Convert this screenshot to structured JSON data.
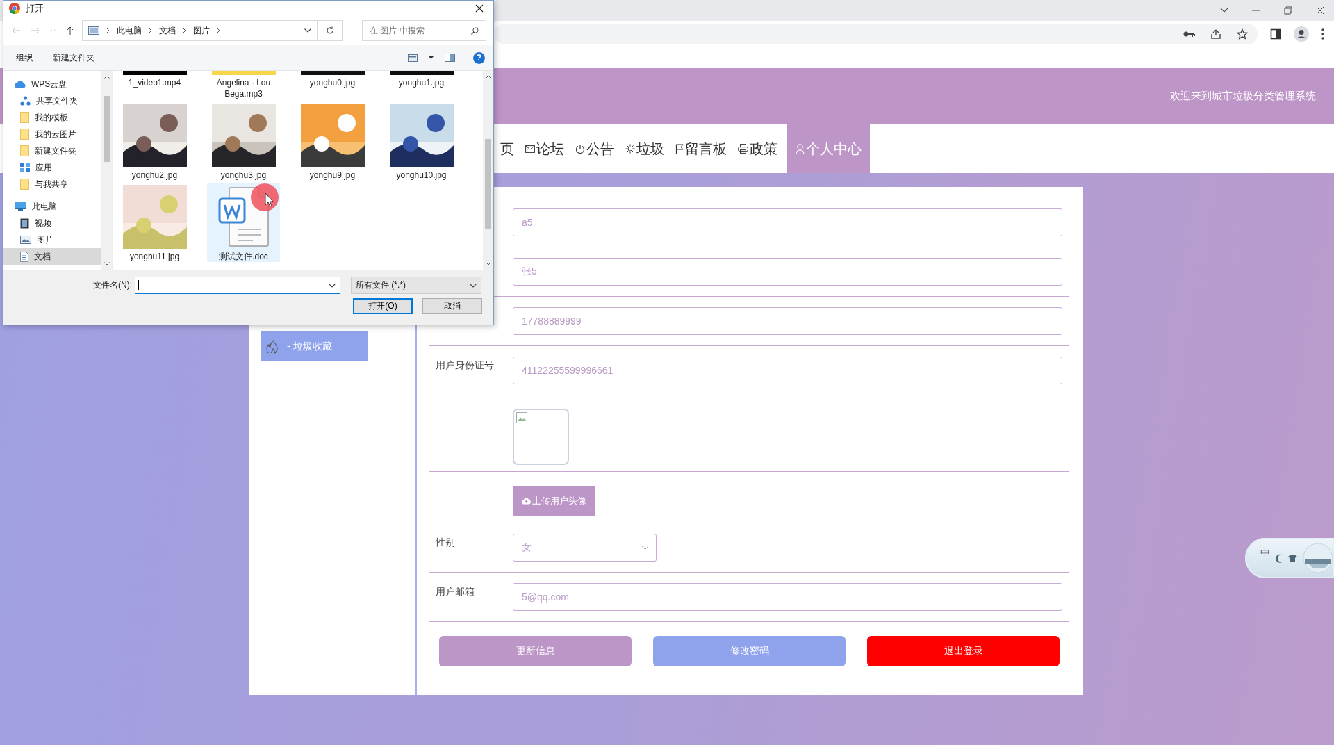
{
  "dialog": {
    "title": "打开",
    "breadcrumb": [
      "此电脑",
      "文档",
      "图片"
    ],
    "search": {
      "placeholder": "在 图片 中搜索"
    },
    "toolbar": [
      "组织",
      "新建文件夹"
    ],
    "help": "?",
    "tree": [
      {
        "label": "WPS云盘",
        "kind": "cloud",
        "selected": false,
        "children": [
          {
            "label": "共享文件夹",
            "kind": "share",
            "selected": false
          },
          {
            "label": "我的模板",
            "kind": "folder",
            "selected": false
          },
          {
            "label": "我的云图片",
            "kind": "folder",
            "selected": false
          },
          {
            "label": "新建文件夹",
            "kind": "folder",
            "selected": false
          },
          {
            "label": "应用",
            "kind": "apps",
            "selected": false
          },
          {
            "label": "与我共享",
            "kind": "folder",
            "selected": false
          }
        ]
      },
      {
        "label": "此电脑",
        "kind": "pc",
        "selected": false,
        "children": [
          {
            "label": "视频",
            "kind": "video",
            "selected": false
          },
          {
            "label": "图片",
            "kind": "picture",
            "selected": false
          },
          {
            "label": "文档",
            "kind": "document",
            "selected": true
          }
        ]
      }
    ],
    "files": [
      {
        "name": "1_video1.mp4",
        "kind": "picture",
        "selected": false
      },
      {
        "name": "Angelina - Lou Bega.mp3",
        "kind": "picture",
        "selected": false
      },
      {
        "name": "yonghu0.jpg",
        "kind": "picture",
        "selected": false
      },
      {
        "name": "yonghu1.jpg",
        "kind": "picture",
        "selected": false
      },
      {
        "name": "yonghu2.jpg",
        "kind": "picture",
        "selected": false
      },
      {
        "name": "yonghu3.jpg",
        "kind": "picture",
        "selected": false
      },
      {
        "name": "yonghu9.jpg",
        "kind": "picture",
        "selected": false
      },
      {
        "name": "yonghu10.jpg",
        "kind": "picture",
        "selected": false
      },
      {
        "name": "yonghu11.jpg",
        "kind": "picture",
        "selected": false
      },
      {
        "name": "测试文件.doc",
        "kind": "document",
        "selected": true
      }
    ],
    "filename": {
      "label": "文件名(N):"
    },
    "filetype": "所有文件 (*.*)",
    "buttons": [
      "打开(O)",
      "取消"
    ]
  },
  "site": {
    "welcome": "欢迎来到城市垃圾分类管理系统",
    "nav": [
      {
        "label": "页",
        "kind": "none",
        "selected": false
      },
      {
        "label": "论坛",
        "kind": "mail",
        "selected": false
      },
      {
        "label": "公告",
        "kind": "power",
        "selected": false
      },
      {
        "label": "垃圾",
        "kind": "gear",
        "selected": false
      },
      {
        "label": "留言板",
        "kind": "flag",
        "selected": false
      },
      {
        "label": "政策",
        "kind": "print",
        "selected": false
      },
      {
        "label": "个人中心",
        "kind": "user",
        "selected": true
      }
    ],
    "sidebar": [
      {
        "label": "-  垃圾收藏",
        "kind": "fire",
        "selected": true
      }
    ],
    "form": [
      {
        "kind": "input",
        "value": "a5"
      },
      {
        "kind": "input",
        "value": "张5"
      },
      {
        "kind": "input",
        "value": "17788889999"
      },
      {
        "kind": "input",
        "label": "用户身份证号",
        "value": "41122255599996661"
      },
      {
        "kind": "avatar"
      },
      {
        "kind": "upload",
        "button": "上传用户头像"
      },
      {
        "kind": "select",
        "label": "性别",
        "value": "女"
      },
      {
        "kind": "input",
        "label": "用户邮箱",
        "value": "5@qq.com"
      }
    ],
    "buttons": [
      {
        "label": "更新信息",
        "color": "#bd96c8"
      },
      {
        "label": "修改密码",
        "color": "#8fa2ec"
      },
      {
        "label": "退出登录",
        "color": "#ff0000"
      }
    ]
  },
  "ime": {
    "label": "中"
  }
}
